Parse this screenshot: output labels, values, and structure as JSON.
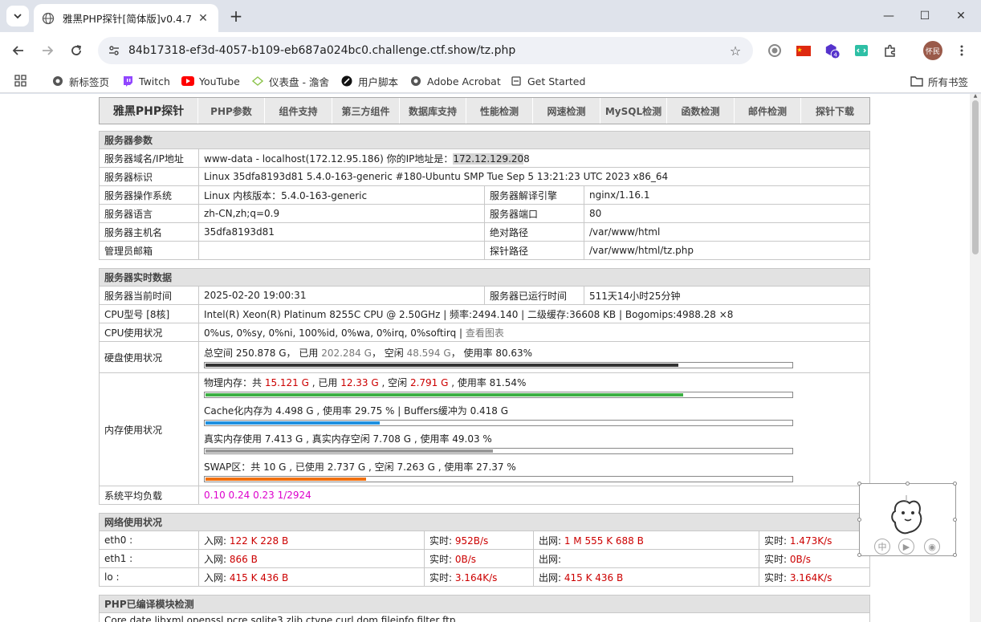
{
  "browser": {
    "tab_title": "雅黑PHP探针[简体版]v0.4.7",
    "url": "84b17318-ef3d-4057-b109-eb687a024bc0.challenge.ctf.show/tz.php",
    "extension_badge": "4",
    "profile_label": "怀民",
    "bookmarks": [
      "新标签页",
      "Twitch",
      "YouTube",
      "仪表盘 - 澹舍",
      "用户脚本",
      "Adobe Acrobat",
      "Get Started"
    ],
    "all_bookmarks": "所有书签"
  },
  "nav": {
    "items": [
      "雅黑PHP探针",
      "PHP参数",
      "组件支持",
      "第三方组件",
      "数据库支持",
      "性能检测",
      "网速检测",
      "MySQL检测",
      "函数检测",
      "邮件检测",
      "探针下载"
    ]
  },
  "server_params": {
    "title": "服务器参数",
    "domain_label": "服务器域名/IP地址",
    "domain_value": "www-data - localhost(172.12.95.186)  你的IP地址是：",
    "client_ip_a": "172.12.129.20",
    "client_ip_b": "8",
    "ident_label": "服务器标识",
    "ident_value": "Linux 35dfa8193d81 5.4.0-163-generic #180-Ubuntu SMP Tue Sep 5 13:21:23 UTC 2023 x86_64",
    "os_label": "服务器操作系统",
    "os_value": "Linux  内核版本：5.4.0-163-generic",
    "engine_label": "服务器解译引擎",
    "engine_value": "nginx/1.16.1",
    "lang_label": "服务器语言",
    "lang_value": "zh-CN,zh;q=0.9",
    "port_label": "服务器端口",
    "port_value": "80",
    "host_label": "服务器主机名",
    "host_value": "35dfa8193d81",
    "abspath_label": "绝对路径",
    "abspath_value": "/var/www/html",
    "admin_label": "管理员邮箱",
    "admin_value": "",
    "probe_label": "探针路径",
    "probe_value": "/var/www/html/tz.php"
  },
  "realtime": {
    "title": "服务器实时数据",
    "time_label": "服务器当前时间",
    "time_value": "2025-02-20 19:00:31",
    "uptime_label": "服务器已运行时间",
    "uptime_value": "511天14小时25分钟",
    "cpu_model_label": "CPU型号 [8核]",
    "cpu_model_value": "Intel(R) Xeon(R) Platinum 8255C CPU @ 2.50GHz | 频率:2494.140 | 二级缓存:36608 KB | Bogomips:4988.28 ×8",
    "cpu_usage_label": "CPU使用状况",
    "cpu_usage_value": "0%us, 0%sy, 0%ni, 100%id, 0%wa, 0%irq, 0%softirq | ",
    "cpu_chart_link": "查看图表",
    "disk_label": "硬盘使用状况",
    "disk_total_prefix": "总空间 250.878 G，  已用 ",
    "disk_used": "202.284 G",
    "disk_free_prefix": "，  空闲 ",
    "disk_free": "48.594 G",
    "disk_rate": "，  使用率 80.63%",
    "disk_pct": 80.63,
    "mem_label": "内存使用状况",
    "phys_prefix": "物理内存：共 ",
    "phys_total": "15.121 G",
    "phys_used_prefix": " , 已用 ",
    "phys_used": "12.33 G",
    "phys_free_prefix": " , 空闲 ",
    "phys_free": "2.791 G",
    "phys_rate": " , 使用率 81.54%",
    "phys_pct": 81.54,
    "cache_text": "Cache化内存为 4.498 G , 使用率 29.75 % | Buffers缓冲为 0.418 G",
    "cache_pct": 29.75,
    "real_text": "真实内存使用 7.413 G , 真实内存空闲 7.708 G , 使用率 49.03 %",
    "real_pct": 49.03,
    "swap_text": "SWAP区：共 10 G , 已使用 2.737 G , 空闲 7.263 G , 使用率 27.37 %",
    "swap_pct": 27.37,
    "load_label": "系统平均负载",
    "load_value": "0.10 0.24 0.23 1/2924"
  },
  "network": {
    "title": "网络使用状况",
    "rows": [
      {
        "iface": "eth0 :",
        "in_label": "入网: ",
        "in": "122 K 228 B",
        "rt_label": "实时: ",
        "rt_in": "952B/s",
        "out_label": "出网: ",
        "out": "1 M 555 K 688 B",
        "rt_label2": "实时: ",
        "rt_out": "1.473K/s"
      },
      {
        "iface": "eth1 :",
        "in_label": "入网: ",
        "in": "866 B",
        "rt_label": "实时: ",
        "rt_in": "0B/s",
        "out_label": "出网: ",
        "out": "",
        "rt_label2": "实时: ",
        "rt_out": "0B/s"
      },
      {
        "iface": "lo :",
        "in_label": "入网: ",
        "in": "415 K 436 B",
        "rt_label": "实时: ",
        "rt_in": "3.164K/s",
        "out_label": "出网: ",
        "out": "415 K 436 B",
        "rt_label2": "实时: ",
        "rt_out": "3.164K/s"
      }
    ]
  },
  "modules": {
    "title": "PHP已编译模块检测",
    "list": "Core  date  libxml  openssl  pcre  sqlite3  zlib  ctype  curl  dom  fileinfo  filter  ftp"
  },
  "colors": {
    "disk_bar": "#333333",
    "phys_bar": "#3cb043",
    "cache_bar": "#1e90e0",
    "real_bar": "#999999",
    "swap_bar": "#f07010"
  }
}
